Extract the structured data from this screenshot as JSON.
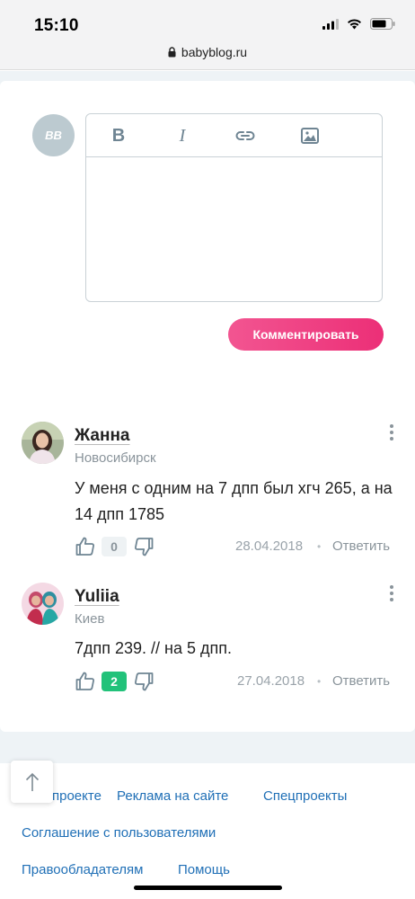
{
  "status": {
    "time": "15:10"
  },
  "browser": {
    "url": "babyblog.ru"
  },
  "avatar_initials": "BB",
  "editor": {
    "bold_label": "B",
    "italic_label": "I",
    "submit_label": "Комментировать"
  },
  "comments": [
    {
      "name": "Жанна",
      "city": "Новосибирск",
      "text": "У меня с одним на 7 дпп был хгч 265, а на 14 дпп 1785",
      "score": "0",
      "date": "28.04.2018",
      "reply": "Ответить"
    },
    {
      "name": "Yuliia",
      "city": "Киев",
      "text": "7дпп 239. // на 5 дпп.",
      "score": "2",
      "date": "27.04.2018",
      "reply": "Ответить"
    }
  ],
  "separator": "•",
  "footer": {
    "links": [
      "проекте",
      "Реклама на сайте",
      "Спецпроекты",
      "Соглашение с пользователями",
      "Правообладателям",
      "Помощь"
    ]
  },
  "colors": {
    "accent": "#ec2f77",
    "link": "#1f6fb6",
    "positive": "#22c27a"
  }
}
